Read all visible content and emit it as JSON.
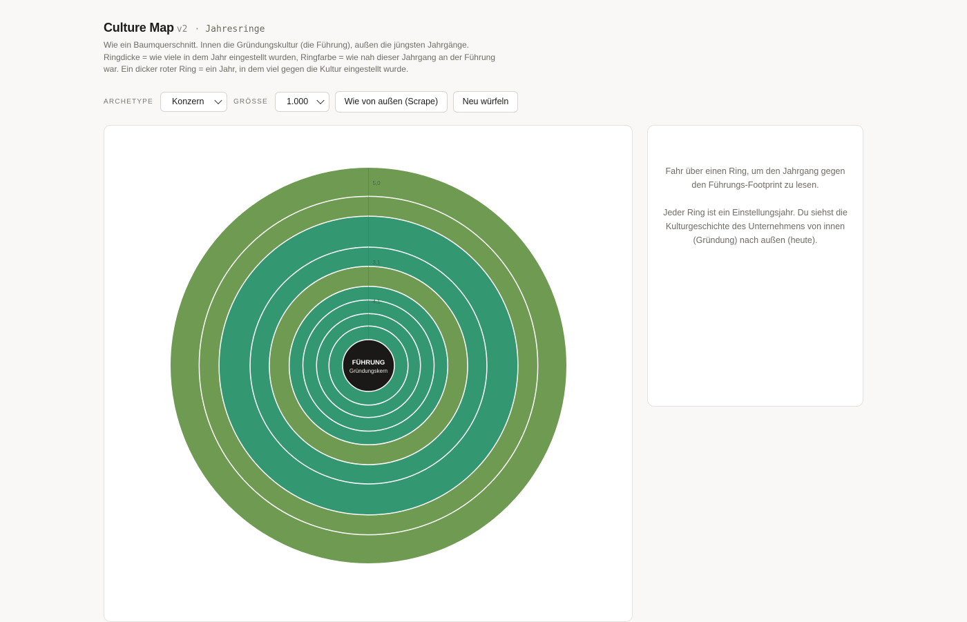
{
  "header": {
    "title": "Culture Map",
    "version": "v2",
    "separator": "·",
    "subtitle": "Jahresringe",
    "description": "Wie ein Baumquerschnitt. Innen die Gründungskultur (die Führung), außen die jüngsten Jahrgänge. Ringdicke = wie viele in dem Jahr eingestellt wurden, Ringfarbe = wie nah dieser Jahrgang an der Führung war. Ein dicker roter Ring = ein Jahr, in dem viel gegen die Kultur eingestellt wurde."
  },
  "controls": {
    "archetype_label": "ARCHETYPE",
    "archetype_value": "Konzern",
    "size_label": "GRÖSSE",
    "size_value": "1.000",
    "scrape_button": "Wie von außen (Scrape)",
    "reroll_button": "Neu würfeln"
  },
  "info_panel": {
    "paragraph_1": "Fahr über einen Ring, um den Jahrgang gegen den Führungs-Footprint zu lesen.",
    "paragraph_2": "Jeder Ring ist ein Einstellungsjahr. Du siehst die Kulturgeschichte des Unternehmens von innen (Gründung) nach außen (heute)."
  },
  "colors": {
    "ring_green": "#339771",
    "ring_olive": "#6f9a52",
    "core": "#1a1917",
    "ring_border": "#ffffff"
  },
  "chart_data": {
    "type": "ring",
    "center_label": "FÜHRUNG",
    "center_sublabel": "Gründungskern",
    "tick_labels": [
      "5,0",
      "3,1",
      "4,1"
    ],
    "rings": [
      {
        "relative_thickness": 22,
        "fill": "#339771"
      },
      {
        "relative_thickness": 20,
        "fill": "#339771"
      },
      {
        "relative_thickness": 22,
        "fill": "#339771"
      },
      {
        "relative_thickness": 22,
        "fill": "#339771"
      },
      {
        "relative_thickness": 32,
        "fill": "#6f9a52"
      },
      {
        "relative_thickness": 31,
        "fill": "#339771"
      },
      {
        "relative_thickness": 50,
        "fill": "#339771"
      },
      {
        "relative_thickness": 32,
        "fill": "#6f9a52"
      },
      {
        "relative_thickness": 46,
        "fill": "#6f9a52"
      }
    ]
  }
}
